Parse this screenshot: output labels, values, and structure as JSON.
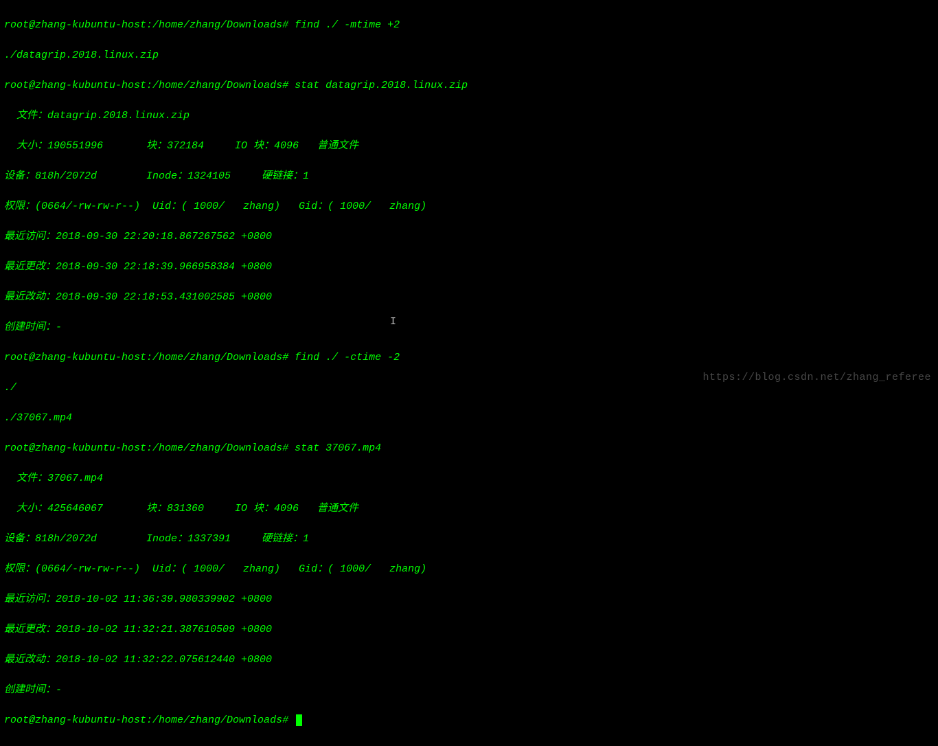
{
  "prompt": "root@zhang-kubuntu-host:/home/zhang/Downloads# ",
  "cmd1": "find ./ -mtime +2",
  "out1_l1": "./datagrip.2018.linux.zip",
  "cmd2": "stat datagrip.2018.linux.zip",
  "stat1": {
    "file": "  文件：datagrip.2018.linux.zip",
    "size": "  大小：190551996       块：372184     IO 块：4096   普通文件",
    "dev": "设备：818h/2072d        Inode：1324105     硬链接：1",
    "perm": "权限：(0664/-rw-rw-r--)  Uid：( 1000/   zhang)   Gid：( 1000/   zhang)",
    "atime": "最近访问：2018-09-30 22:20:18.867267562 +0800",
    "mtime": "最近更改：2018-09-30 22:18:39.966958384 +0800",
    "ctime": "最近改动：2018-09-30 22:18:53.431002585 +0800",
    "birth": "创建时间：-"
  },
  "cmd3": "find ./ -ctime -2",
  "out3_l1": "./",
  "out3_l2": "./37067.mp4",
  "cmd4": "stat 37067.mp4",
  "stat2": {
    "file": "  文件：37067.mp4",
    "size": "  大小：425646067       块：831360     IO 块：4096   普通文件",
    "dev": "设备：818h/2072d        Inode：1337391     硬链接：1",
    "perm": "权限：(0664/-rw-rw-r--)  Uid：( 1000/   zhang)   Gid：( 1000/   zhang)",
    "atime": "最近访问：2018-10-02 11:36:39.980339902 +0800",
    "mtime": "最近更改：2018-10-02 11:32:21.387610509 +0800",
    "ctime": "最近改动：2018-10-02 11:32:22.075612440 +0800",
    "birth": "创建时间：-"
  },
  "watermark": "https://blog.csdn.net/zhang_referee"
}
